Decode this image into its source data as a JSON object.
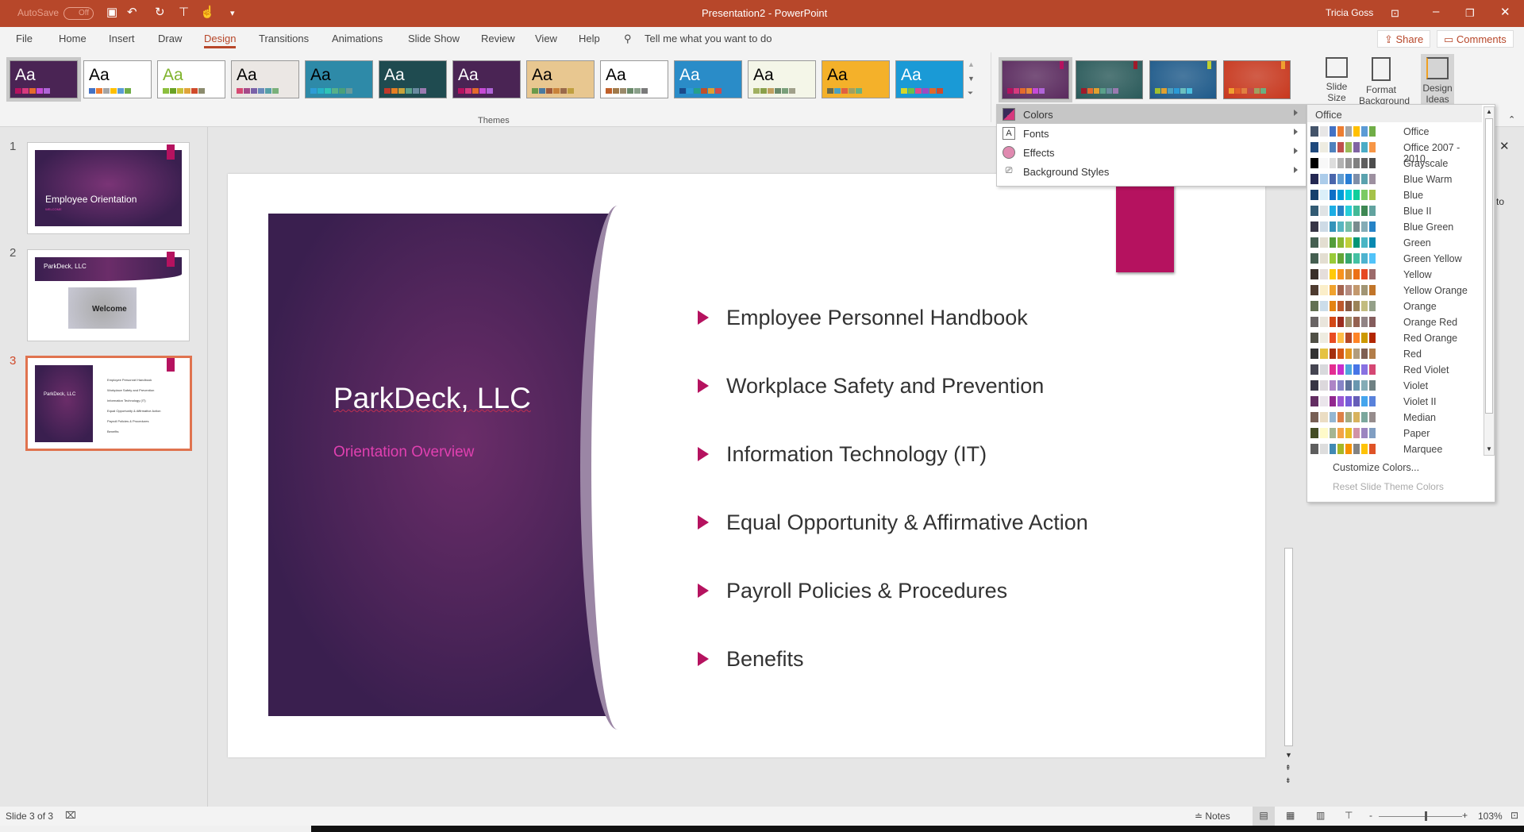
{
  "titlebar": {
    "autosave": "AutoSave",
    "autosave_state": "Off",
    "doc_title": "Presentation2  -  PowerPoint",
    "user": "Tricia Goss",
    "bg": "#b7472a"
  },
  "tabs": [
    "File",
    "Home",
    "Insert",
    "Draw",
    "Design",
    "Transitions",
    "Animations",
    "Slide Show",
    "Review",
    "View",
    "Help"
  ],
  "active_tab": "Design",
  "tell_me": "Tell me what you want to do",
  "share": "Share",
  "comments": "Comments",
  "ribbon": {
    "themes_label": "Themes",
    "slide_size": "Slide Size",
    "format_background": "Format Background",
    "design_ideas": "Design Ideas",
    "theme_glyph": "Aa"
  },
  "themes": [
    {
      "bg": "#4a2454",
      "fg": "#fff",
      "sw": [
        "#b5125f",
        "#d63a7e",
        "#e46a2c",
        "#c64ad6",
        "#b064d8"
      ]
    },
    {
      "bg": "#fff",
      "fg": "#000",
      "sw": [
        "#4472c4",
        "#ed7d31",
        "#a5a5a5",
        "#ffc000",
        "#5b9bd5",
        "#70ad47"
      ]
    },
    {
      "bg": "#fff",
      "fg": "#7fb32c",
      "sw": [
        "#8cbf3e",
        "#6aa225",
        "#c7c13a",
        "#e0a43a",
        "#d04a2a",
        "#8c8c6e"
      ]
    },
    {
      "bg": "#ebe7e4",
      "fg": "#000",
      "sw": [
        "#d64a73",
        "#a54a8a",
        "#7a62a8",
        "#6a8abb",
        "#55a0a8",
        "#7ab07a"
      ]
    },
    {
      "bg": "#2e8aa8",
      "fg": "#000",
      "sw": [
        "#2e9cd6",
        "#26b0c6",
        "#2ec4b6",
        "#56b08a",
        "#4aa07a",
        "#6a9a9a"
      ]
    },
    {
      "bg": "#1f4b50",
      "fg": "#fff",
      "sw": [
        "#c0392b",
        "#e67e22",
        "#c8a33a",
        "#5aa08a",
        "#6a8aa0",
        "#9a7ab0"
      ]
    },
    {
      "bg": "#4a2454",
      "fg": "#fff",
      "sw": [
        "#b5125f",
        "#d63a7e",
        "#e46a2c",
        "#c64ad6",
        "#b064d8"
      ]
    },
    {
      "bg": "#e8c790",
      "fg": "#000",
      "sw": [
        "#6a9a4a",
        "#4a7aa0",
        "#a05a3a",
        "#c8823a",
        "#9a6a4a",
        "#c0a040"
      ]
    },
    {
      "bg": "#fff",
      "fg": "#000",
      "sw": [
        "#c0602a",
        "#a07a4a",
        "#9a8a6a",
        "#6a8a6a",
        "#8aa08a",
        "#7a7a7a"
      ]
    },
    {
      "bg": "#2a8cc8",
      "fg": "#fff",
      "sw": [
        "#1a4a8a",
        "#2a9ad6",
        "#26a08a",
        "#c0502a",
        "#e0a030",
        "#d04a4a"
      ]
    },
    {
      "bg": "#f4f6e8",
      "fg": "#000",
      "sw": [
        "#a0b060",
        "#8aa04a",
        "#c0a060",
        "#6a8a6a",
        "#7aa07a",
        "#a0a08a"
      ]
    },
    {
      "bg": "#f4b12a",
      "fg": "#000",
      "sw": [
        "#6a6a4a",
        "#4aa0c0",
        "#e06040",
        "#a0a060",
        "#6ab080"
      ]
    },
    {
      "bg": "#1a9ad6",
      "fg": "#fff",
      "sw": [
        "#d6d62a",
        "#6ac04a",
        "#e04a8a",
        "#a04ac0",
        "#e06a2a",
        "#d04a2a"
      ]
    }
  ],
  "variants": [
    {
      "bg": "#5a2a5e",
      "tag": "#b5125f",
      "sw": [
        "#b5125f",
        "#d63a7e",
        "#e46a2c",
        "#e58a3a",
        "#c64ad6",
        "#b064d8"
      ]
    },
    {
      "bg": "#2a5a5a",
      "tag": "#a01a2a",
      "sw": [
        "#a01a2a",
        "#e46a2c",
        "#e0a030",
        "#5aa08a",
        "#6a8aa0",
        "#9a7ab0"
      ]
    },
    {
      "bg": "#1e5a8a",
      "tag": "#c0d030",
      "sw": [
        "#a0c030",
        "#e0a030",
        "#4aa0c0",
        "#2a9ad6",
        "#6ac0c0",
        "#4ac0e0"
      ]
    },
    {
      "bg": "#c8381e",
      "tag": "#f0a030",
      "sw": [
        "#f0a030",
        "#e0602a",
        "#e08040",
        "#c04a4a",
        "#a0a060",
        "#6ab080"
      ]
    }
  ],
  "theme_menu": {
    "items": [
      {
        "label": "Colors",
        "icon": "colors-icon"
      },
      {
        "label": "Fonts",
        "icon": "fonts-icon"
      },
      {
        "label": "Effects",
        "icon": "effects-icon"
      },
      {
        "label": "Background Styles",
        "icon": "background-styles-icon"
      }
    ]
  },
  "colors_submenu": {
    "header": "Office",
    "customize": "Customize Colors...",
    "reset": "Reset Slide Theme Colors",
    "schemes": [
      {
        "name": "Office",
        "sw": [
          "#44546a",
          "#e7e6e6",
          "#4472c4",
          "#ed7d31",
          "#a5a5a5",
          "#ffc000",
          "#5b9bd5",
          "#70ad47"
        ]
      },
      {
        "name": "Office 2007 - 2010",
        "sw": [
          "#1f497d",
          "#eeece1",
          "#4f81bd",
          "#c0504d",
          "#9bbb59",
          "#8064a2",
          "#4bacc6",
          "#f79646"
        ]
      },
      {
        "name": "Grayscale",
        "sw": [
          "#000000",
          "#f8f8f8",
          "#dddddd",
          "#b2b2b2",
          "#969696",
          "#808080",
          "#5f5f5f",
          "#4d4d4d"
        ]
      },
      {
        "name": "Blue Warm",
        "sw": [
          "#242852",
          "#acccea",
          "#4a66ac",
          "#629dd1",
          "#297fd5",
          "#7f8fa9",
          "#5aa2ae",
          "#9d90a0"
        ]
      },
      {
        "name": "Blue",
        "sw": [
          "#17406d",
          "#dbeff9",
          "#0f6fc6",
          "#009dd9",
          "#0bd0d9",
          "#10cf9b",
          "#7cca62",
          "#a5c249"
        ]
      },
      {
        "name": "Blue II",
        "sw": [
          "#335b74",
          "#dfe3e5",
          "#1cade4",
          "#2683c6",
          "#27ced7",
          "#42ba97",
          "#3e8853",
          "#62a39f"
        ]
      },
      {
        "name": "Blue Green",
        "sw": [
          "#373545",
          "#cedbe6",
          "#3494ba",
          "#58b6c0",
          "#75bda7",
          "#7a8c8e",
          "#84acb6",
          "#2683c6"
        ]
      },
      {
        "name": "Green",
        "sw": [
          "#455f51",
          "#e3ded1",
          "#549e39",
          "#8ab833",
          "#c0cf3a",
          "#029676",
          "#4ab5c4",
          "#0989b1"
        ]
      },
      {
        "name": "Green Yellow",
        "sw": [
          "#455f51",
          "#e3ded1",
          "#99cb38",
          "#63a537",
          "#37a76f",
          "#44c1a3",
          "#4eb3cf",
          "#51c3f9"
        ]
      },
      {
        "name": "Yellow",
        "sw": [
          "#39302a",
          "#e5dedb",
          "#ffca08",
          "#f8931d",
          "#ce8d3e",
          "#ec7016",
          "#e64823",
          "#9c6a6a"
        ]
      },
      {
        "name": "Yellow Orange",
        "sw": [
          "#4e3b30",
          "#fbeec9",
          "#f0a22e",
          "#a5644e",
          "#b58b80",
          "#c3986d",
          "#a19574",
          "#c17529"
        ]
      },
      {
        "name": "Orange",
        "sw": [
          "#637052",
          "#ccddea",
          "#e48312",
          "#bd582c",
          "#865640",
          "#9b8357",
          "#c2bc80",
          "#94a088"
        ]
      },
      {
        "name": "Orange Red",
        "sw": [
          "#696464",
          "#e9e5dc",
          "#d34817",
          "#9b2d1f",
          "#a28e6a",
          "#956251",
          "#918485",
          "#855d5d"
        ]
      },
      {
        "name": "Red Orange",
        "sw": [
          "#505046",
          "#eeece1",
          "#e84c22",
          "#ffbd47",
          "#b64926",
          "#ff8427",
          "#cc9900",
          "#b22600"
        ]
      },
      {
        "name": "Red",
        "sw": [
          "#323232",
          "#e5c243",
          "#a5300f",
          "#d55816",
          "#e19825",
          "#b19c7d",
          "#7f5f52",
          "#b27d49"
        ]
      },
      {
        "name": "Red Violet",
        "sw": [
          "#454551",
          "#d8d9dc",
          "#e32d91",
          "#c830cc",
          "#4ea6dc",
          "#4775e7",
          "#8971e1",
          "#d54773"
        ]
      },
      {
        "name": "Violet",
        "sw": [
          "#373545",
          "#dcd8dc",
          "#ad84c6",
          "#8784c7",
          "#5d739a",
          "#6997af",
          "#84acb6",
          "#6f8183"
        ]
      },
      {
        "name": "Violet II",
        "sw": [
          "#632e62",
          "#eae5eb",
          "#92278f",
          "#9b57d3",
          "#755dd9",
          "#665eb8",
          "#45a5ed",
          "#5982db"
        ]
      },
      {
        "name": "Median",
        "sw": [
          "#775f55",
          "#ebddc3",
          "#94b6d2",
          "#dd8047",
          "#a5ab81",
          "#d8b25c",
          "#7ba79d",
          "#968c8c"
        ]
      },
      {
        "name": "Paper",
        "sw": [
          "#444d26",
          "#fefac9",
          "#a5b592",
          "#f3a447",
          "#e7bc29",
          "#d092a7",
          "#9c85c0",
          "#809ec2"
        ]
      },
      {
        "name": "Marquee",
        "sw": [
          "#5e5e5e",
          "#dddddd",
          "#418ab3",
          "#a6b727",
          "#f69200",
          "#838383",
          "#fec306",
          "#df5327"
        ]
      }
    ]
  },
  "slides": [
    {
      "number": "1",
      "title": "Employee Orientation",
      "subtitle": "WELCOME"
    },
    {
      "number": "2",
      "title": "ParkDeck, LLC",
      "image_text": "Welcome"
    },
    {
      "number": "3",
      "title": "ParkDeck, LLC",
      "subtitle": "Orientation Overview"
    }
  ],
  "current_slide": {
    "title": "ParkDeck, LLC",
    "subtitle": "Orientation Overview",
    "bullets": [
      "Employee Personnel Handbook",
      "Workplace Safety and Prevention",
      "Information Technology (IT)",
      "Equal Opportunity & Affirmative Action",
      "Payroll Policies & Procedures",
      "Benefits"
    ],
    "accent": "#b5125f",
    "title_color": "#ffffff",
    "subtitle_color": "#e040b0"
  },
  "side_pane_fragment": "to",
  "status": {
    "slide_info": "Slide 3 of 3",
    "notes": "Notes",
    "zoom": "103%",
    "zoom_level": 0.55
  }
}
